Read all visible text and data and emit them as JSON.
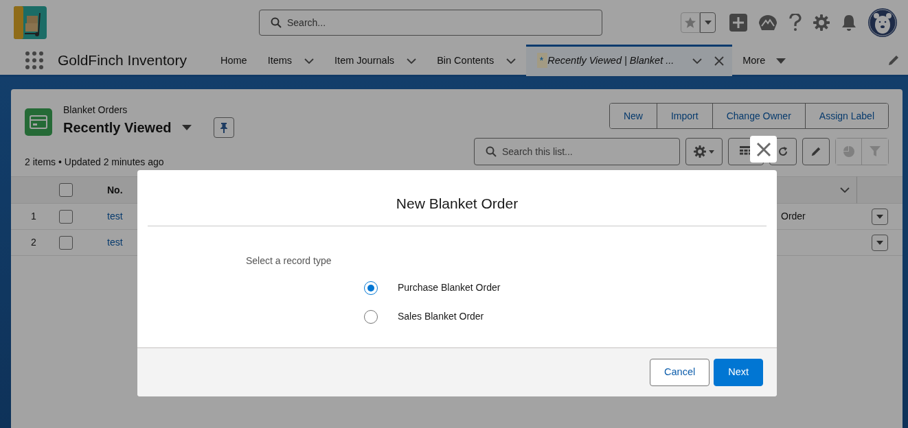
{
  "global_search": {
    "placeholder": "Search..."
  },
  "app": {
    "name": "GoldFinch Inventory"
  },
  "nav_tabs": [
    {
      "label": "Home",
      "has_menu": false,
      "selected": false,
      "closable": false
    },
    {
      "label": "Items",
      "has_menu": true,
      "selected": false,
      "closable": false
    },
    {
      "label": "Item Journals",
      "has_menu": true,
      "selected": false,
      "closable": false
    },
    {
      "label": "Bin Contents",
      "has_menu": true,
      "selected": false,
      "closable": false
    },
    {
      "prefix": "*",
      "label": "Recently Viewed | Blanket ...",
      "has_menu": true,
      "selected": true,
      "closable": true
    }
  ],
  "more_tab": {
    "label": "More"
  },
  "list_view": {
    "object": "Blanket Orders",
    "title": "Recently Viewed",
    "actions": [
      "New",
      "Import",
      "Change Owner",
      "Assign Label"
    ],
    "status": "2 items • Updated 2 minutes ago",
    "search": {
      "placeholder": "Search this list..."
    },
    "select_all": {
      "checked": false
    },
    "columns": [
      {
        "label": "No."
      }
    ],
    "rows": [
      {
        "number": "1",
        "checked": false,
        "no": "test",
        "column_3": "Order"
      },
      {
        "number": "2",
        "checked": false,
        "no": "test"
      }
    ]
  },
  "modal": {
    "title": "New Blanket Order",
    "prompt": "Select a record type",
    "options": [
      {
        "label": "Purchase Blanket Order",
        "selected": true
      },
      {
        "label": "Sales Blanket Order",
        "selected": false
      }
    ],
    "buttons": [
      {
        "label": "Cancel",
        "kind": "neutral"
      },
      {
        "label": "Next",
        "kind": "brand"
      }
    ]
  }
}
